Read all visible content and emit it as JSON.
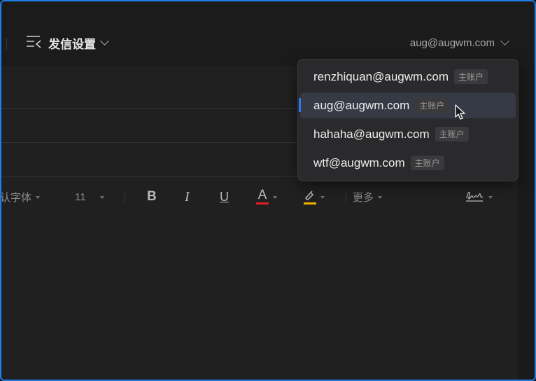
{
  "header": {
    "send_settings_label": "发信设置",
    "sender_current": "aug@augwm.com"
  },
  "account_dropdown": {
    "items": [
      {
        "email": "renzhiquan@augwm.com",
        "tag": "主账户",
        "selected": false
      },
      {
        "email": "aug@augwm.com",
        "tag": "主账户",
        "selected": true
      },
      {
        "email": "hahaha@augwm.com",
        "tag": "主账户",
        "selected": false
      },
      {
        "email": "wtf@augwm.com",
        "tag": "主账户",
        "selected": false
      }
    ]
  },
  "format_toolbar": {
    "font_family": "认字体",
    "font_size": "11",
    "bold": "B",
    "italic": "I",
    "underline": "U",
    "font_color": "A",
    "more": "更多"
  },
  "colors": {
    "accent": "#2b7cf5",
    "font_color_bar": "#e02020",
    "highlight_bar": "#f0b400"
  }
}
